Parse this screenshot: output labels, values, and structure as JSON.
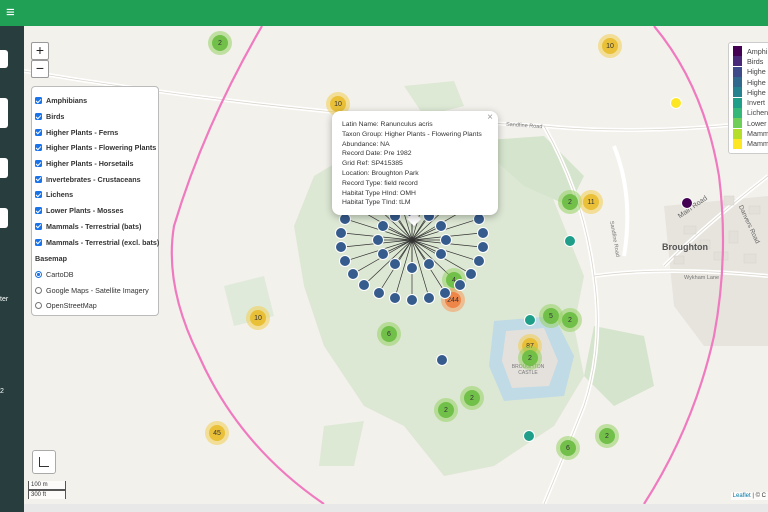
{
  "header": {
    "menu_icon": "hamburger-icon"
  },
  "sidebar": {
    "partial_text_1": "ter",
    "partial_text_2": "2"
  },
  "map_controls": {
    "zoom_in": "+",
    "zoom_out": "−"
  },
  "layers": {
    "overlays": [
      {
        "label": "Amphibians",
        "checked": true
      },
      {
        "label": "Birds",
        "checked": true
      },
      {
        "label": "Higher Plants - Ferns",
        "checked": true
      },
      {
        "label": "Higher Plants - Flowering Plants",
        "checked": true
      },
      {
        "label": "Higher Plants - Horsetails",
        "checked": true
      },
      {
        "label": "Invertebrates - Crustaceans",
        "checked": true
      },
      {
        "label": "Lichens",
        "checked": true
      },
      {
        "label": "Lower Plants - Mosses",
        "checked": true
      },
      {
        "label": "Mammals - Terrestrial (bats)",
        "checked": true
      },
      {
        "label": "Mammals - Terrestrial (excl. bats)",
        "checked": true
      }
    ],
    "basemap_title": "Basemap",
    "basemaps": [
      {
        "label": "CartoDB",
        "selected": true
      },
      {
        "label": "Google Maps - Satellite Imagery",
        "selected": false
      },
      {
        "label": "OpenStreetMap",
        "selected": false
      }
    ]
  },
  "popup": {
    "close": "×",
    "lines": [
      "Latin Name: Ranunculus acris",
      "Taxon Group: Higher Plants - Flowering Plants",
      "Abundance: NA",
      "Record Date: Pre 1982",
      "Grid Ref: SP415385",
      "Location: Broughton Park",
      "Record Type: field record",
      "Habitat Type HInd: OMH",
      "Habitat Type TInd: tLM"
    ]
  },
  "legend": [
    {
      "label": "Amphi",
      "color": "#440154"
    },
    {
      "label": "Birds",
      "color": "#482878"
    },
    {
      "label": "Highe",
      "color": "#3e4a89"
    },
    {
      "label": "Highe",
      "color": "#31688e"
    },
    {
      "label": "Highe",
      "color": "#26828e"
    },
    {
      "label": "Invert",
      "color": "#1f9e89"
    },
    {
      "label": "Lichen",
      "color": "#35b779"
    },
    {
      "label": "Lower",
      "color": "#6ece58"
    },
    {
      "label": "Mamm",
      "color": "#b5de2b"
    },
    {
      "label": "Mamm",
      "color": "#fde725"
    }
  ],
  "clusters": [
    {
      "label": "2",
      "tone": "green"
    },
    {
      "label": "10",
      "tone": "yellow"
    },
    {
      "label": "10",
      "tone": "yellow"
    },
    {
      "label": "2",
      "tone": "green"
    },
    {
      "label": "11",
      "tone": "yellow"
    },
    {
      "label": "4",
      "tone": "green"
    },
    {
      "label": "244",
      "tone": "orange"
    },
    {
      "label": "10",
      "tone": "yellow"
    },
    {
      "label": "6",
      "tone": "green"
    },
    {
      "label": "5",
      "tone": "green"
    },
    {
      "label": "2",
      "tone": "green"
    },
    {
      "label": "87",
      "tone": "yellow"
    },
    {
      "label": "2",
      "tone": "green"
    },
    {
      "label": "2",
      "tone": "green"
    },
    {
      "label": "2",
      "tone": "green"
    },
    {
      "label": "45",
      "tone": "yellow"
    },
    {
      "label": "6",
      "tone": "green"
    },
    {
      "label": "2",
      "tone": "green"
    }
  ],
  "map_labels": {
    "sandfine_road_1": "Sandfine Road",
    "sandfine_road_2": "Sandfine Road",
    "main_road": "Main Road",
    "danvers_road": "Danvers Road",
    "wykham_lane": "Wykham Lane",
    "place_name": "Broughton",
    "castle": "BROUGHTON CASTLE"
  },
  "scale": {
    "metric": "100 m",
    "imperial": "300 ft"
  },
  "attribution": {
    "link": "Leaflet",
    "rest": " | © C"
  },
  "colors": {
    "header": "#1fa055",
    "sidebar": "#283e3e",
    "boundary": "#f07ac0",
    "point_dark": "#365c8d",
    "point_purple": "#440154",
    "point_teal": "#1f9e89",
    "point_yellow": "#fde725"
  }
}
